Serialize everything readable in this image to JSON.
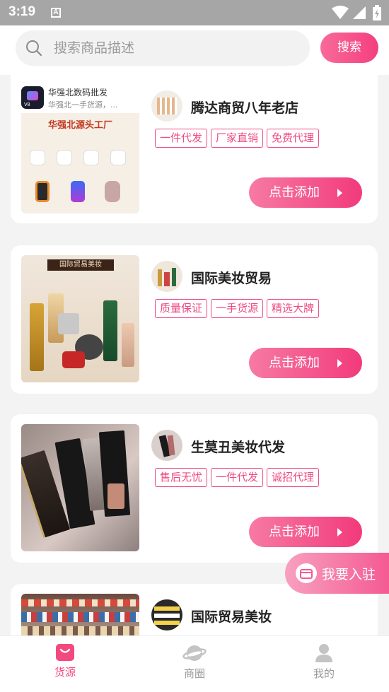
{
  "status_bar": {
    "time": "3:19",
    "notification_letter": "A"
  },
  "search": {
    "placeholder": "搜索商品描述",
    "button_label": "搜索"
  },
  "cards": [
    {
      "thumb_title": "华强北数码批发",
      "thumb_subtitle": "华强北一手货源，...",
      "thumb_banner": "华强北源头工厂",
      "shop_name": "腾达商贸八年老店",
      "tags": [
        "一件代发",
        "厂家直销",
        "免费代理"
      ],
      "add_label": "点击添加"
    },
    {
      "thumb_banner": "国际贸易美妆",
      "shop_name": "国际美妆贸易",
      "tags": [
        "质量保证",
        "一手货源",
        "精选大牌"
      ],
      "add_label": "点击添加"
    },
    {
      "shop_name": "生莫丑美妆代发",
      "tags": [
        "售后无忧",
        "一件代发",
        "诚招代理"
      ],
      "add_label": "点击添加"
    },
    {
      "shop_name": "国际贸易美妆"
    }
  ],
  "join_button": {
    "label": "我要入驻"
  },
  "nav": {
    "items": [
      {
        "label": "货源",
        "icon": "bag-icon",
        "active": true
      },
      {
        "label": "商圈",
        "icon": "planet-icon",
        "active": false
      },
      {
        "label": "我的",
        "icon": "user-icon",
        "active": false
      }
    ]
  },
  "colors": {
    "accent": "#f2497f",
    "tag": "#ee4a84",
    "status_bar": "#a6a6a6"
  }
}
